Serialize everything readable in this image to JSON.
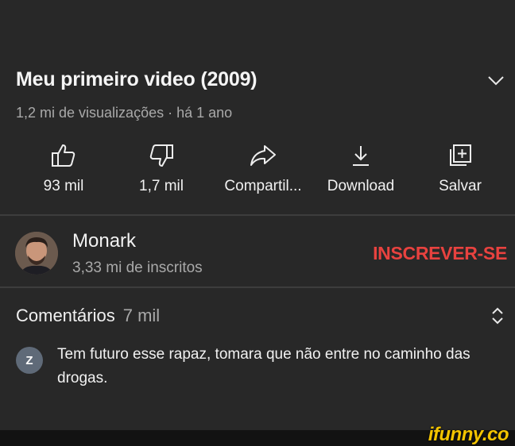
{
  "video": {
    "title": "Meu primeiro video (2009)",
    "meta": "1,2 mi de visualizações · há 1 ano"
  },
  "actions": [
    {
      "icon": "thumbs-up-icon",
      "label": "93 mil"
    },
    {
      "icon": "thumbs-down-icon",
      "label": "1,7 mil"
    },
    {
      "icon": "share-icon",
      "label": "Compartil..."
    },
    {
      "icon": "download-icon",
      "label": "Download"
    },
    {
      "icon": "save-playlist-icon",
      "label": "Salvar"
    }
  ],
  "channel": {
    "name": "Monark",
    "subscribers": "3,33 mi de inscritos",
    "subscribe_label": "INSCREVER-SE"
  },
  "comments": {
    "title": "Comentários",
    "count": "7 mil",
    "top_comment": {
      "avatar_letter": "Z",
      "text": "Tem futuro esse rapaz, tomara que não entre no caminho das drogas."
    }
  },
  "watermark": "ifunny.co",
  "colors": {
    "background": "#282828",
    "subscribe": "#e8423f",
    "secondary_text": "#a9a9a9",
    "watermark": "#f3c400"
  }
}
